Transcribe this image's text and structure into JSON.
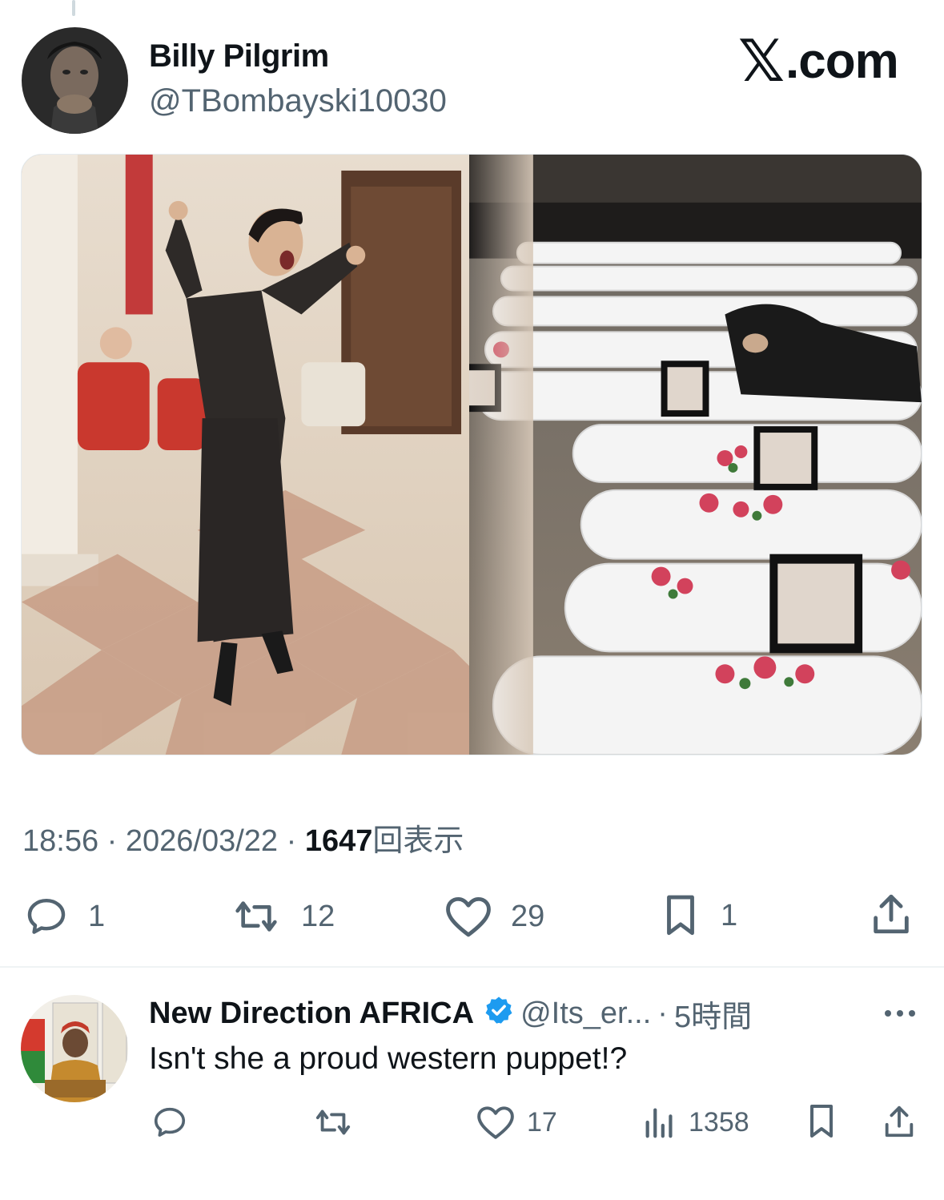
{
  "post": {
    "author_name": "Billy Pilgrim",
    "author_handle": "@TBombayski10030",
    "brand": {
      "mark": "𝕏",
      "domain": ".com"
    },
    "media": {
      "icon": "photo",
      "description": "Split composite image: left side a woman in a dark suit cheering with raised fists in an ornate hall; right side rows of white-shrouded bodies with framed portraits and flowers, mourners in background"
    },
    "time": "18:56",
    "date": "2026/03/22",
    "views_count": "1647",
    "views_label": "回表示",
    "separator": "·",
    "actions": {
      "replies": "1",
      "reposts": "12",
      "likes": "29",
      "bookmarks": "1"
    }
  },
  "reply": {
    "author_name": "New Direction AFRICA",
    "verified": true,
    "handle": "@Its_er...",
    "separator": "·",
    "time": "5時間",
    "text": "Isn't she a proud western puppet!?",
    "actions": {
      "replies": "",
      "reposts": "",
      "likes": "17",
      "views": "1358"
    }
  },
  "colors": {
    "text_primary": "#0f1419",
    "text_secondary": "#536471",
    "verified_blue": "#1d9bf0",
    "divider": "#eff3f4"
  }
}
